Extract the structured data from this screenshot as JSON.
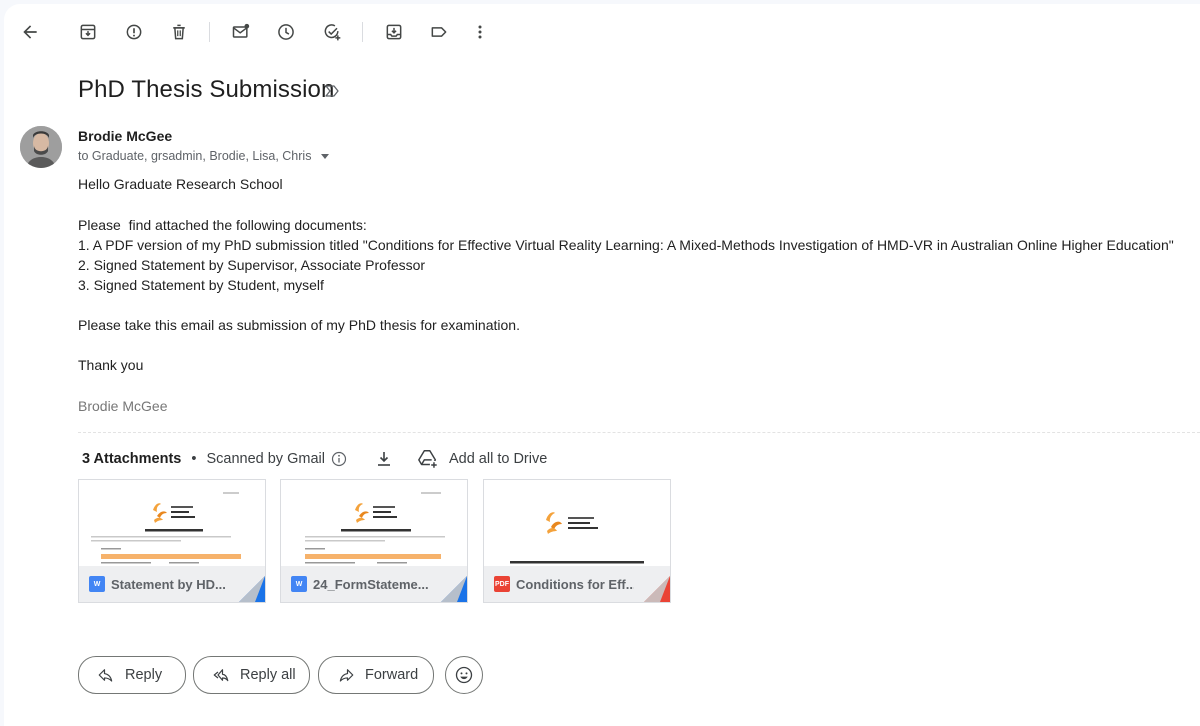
{
  "toolbar": {
    "icons": [
      "back-arrow-icon",
      "archive-icon",
      "report-spam-icon",
      "delete-icon",
      "mark-unread-icon",
      "snooze-icon",
      "add-task-icon",
      "move-to-icon",
      "label-icon",
      "more-vert-icon"
    ]
  },
  "email": {
    "subject": "PhD Thesis Submission",
    "sender": "Brodie McGee",
    "recipients": "to Graduate, grsadmin, Brodie, Lisa, Chris",
    "body": [
      "Hello Graduate Research School",
      "Please  find attached the following documents:",
      "1. A PDF version of my PhD submission titled \"Conditions for Effective Virtual Reality Learning: A Mixed-Methods Investigation of HMD-VR in Australian Online Higher Education\"",
      "2. Signed Statement by Supervisor, Associate Professor",
      "3. Signed Statement by Student, myself",
      "Please take this email as submission of my PhD thesis for examination.",
      "Thank you"
    ],
    "signature": "Brodie McGee"
  },
  "attachments": {
    "count_label": "3 Attachments",
    "separator": "•",
    "scanned_label": "Scanned by Gmail",
    "add_all_label": "Add all to Drive",
    "items": [
      {
        "name": "Statement by HD...",
        "type": "docx",
        "icon_text": "W",
        "icon_color": "#4285f4",
        "corner_color": "#1a73e8",
        "preview_title": "Statement by HDR Student",
        "logo_text_1": "University of",
        "logo_text_2": "Southern",
        "logo_text_3": "Queensland"
      },
      {
        "name": "24_FormStateme...",
        "type": "docx",
        "icon_text": "W",
        "icon_color": "#4285f4",
        "corner_color": "#1a73e8",
        "preview_title": "Statement by HDR Supervisors",
        "logo_text_1": "University of",
        "logo_text_2": "Southern",
        "logo_text_3": "Queensland"
      },
      {
        "name": "Conditions for Eff...",
        "type": "pdf",
        "icon_text": "PDF",
        "icon_color": "#ea4335",
        "corner_color": "#ea4335",
        "preview_title": "CONDITIONS FOR EFFECTIVE VIRTUAL REALITY LEARNING: A",
        "logo_text_1": "University of",
        "logo_text_2": "Southern",
        "logo_text_3": "Queensland"
      }
    ]
  },
  "actions": {
    "reply": "Reply",
    "reply_all": "Reply all",
    "forward": "Forward"
  }
}
